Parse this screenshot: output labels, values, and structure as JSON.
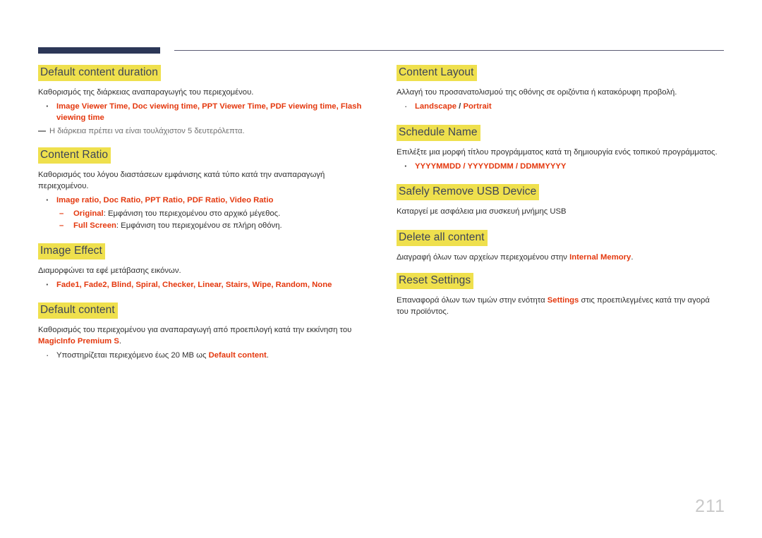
{
  "page": {
    "number": "211",
    "accent_dark": "#2c3757",
    "accent_rule": "#5b5b74",
    "highlight": "#efe04d",
    "keyword_color": "#e4380e",
    "heading_text_color": "#3d4457"
  },
  "left_column": {
    "sections": [
      {
        "heading": "Default content duration",
        "paragraph": "Καθορισμός της διάρκειας αναπαραγωγής του περιεχομένου.",
        "bullet": "Image Viewer Time, Doc viewing time, PPT Viewer Time, PDF viewing time, Flash viewing time",
        "note": "Η διάρκεια πρέπει να είναι τουλάχιστον 5 δευτερόλεπτα."
      },
      {
        "heading": "Content Ratio",
        "paragraph": "Καθορισμός του λόγου διαστάσεων εμφάνισης κατά τύπο κατά την αναπαραγωγή περιεχομένου.",
        "bullet": "Image ratio, Doc Ratio, PPT Ratio, PDF Ratio, Video Ratio",
        "sub_items": [
          {
            "label": "Original",
            "text": ": Εμφάνιση του περιεχομένου στο αρχικό μέγεθος."
          },
          {
            "label": "Full Screen",
            "text": ": Εμφάνιση του περιεχομένου σε πλήρη οθόνη."
          }
        ]
      },
      {
        "heading": "Image Effect",
        "paragraph": "Διαμορφώνει τα εφέ μετάβασης εικόνων.",
        "bullet": "Fade1, Fade2, Blind, Spiral, Checker, Linear, Stairs, Wipe, Random, None"
      },
      {
        "heading": "Default content",
        "paragraph_prefix": "Καθορισμός του περιεχομένου για αναπαραγωγή από προεπιλογή κατά την εκκίνηση του ",
        "paragraph_keyword": "MagicInfo Premium S",
        "paragraph_suffix": ".",
        "bullet_prefix": "Υποστηρίζεται περιεχόμενο έως 20 MB ως ",
        "bullet_keyword": "Default content",
        "bullet_suffix": "."
      }
    ]
  },
  "right_column": {
    "sections": [
      {
        "heading": "Content Layout",
        "paragraph": "Αλλαγή του προσανατολισμού της οθόνης σε οριζόντια ή κατακόρυφη προβολή.",
        "option_a": "Landscape",
        "option_separator": " / ",
        "option_b": "Portrait"
      },
      {
        "heading": "Schedule Name",
        "paragraph": "Επιλέξτε μια μορφή τίτλου προγράμματος κατά τη δημιουργία ενός τοπικού προγράμματος.",
        "bullet": "YYYYMMDD / YYYYDDMM / DDMMYYYY"
      },
      {
        "heading": "Safely Remove USB Device",
        "paragraph": "Καταργεί με ασφάλεια μια συσκευή μνήμης USB"
      },
      {
        "heading": "Delete all content",
        "paragraph_prefix": "Διαγραφή όλων των αρχείων περιεχομένου στην ",
        "paragraph_keyword": "Internal Memory",
        "paragraph_suffix": "."
      },
      {
        "heading": "Reset Settings",
        "paragraph_prefix": "Επαναφορά όλων των τιμών στην ενότητα ",
        "paragraph_keyword": "Settings",
        "paragraph_suffix": " στις προεπιλεγμένες κατά την αγορά του προϊόντος."
      }
    ]
  }
}
